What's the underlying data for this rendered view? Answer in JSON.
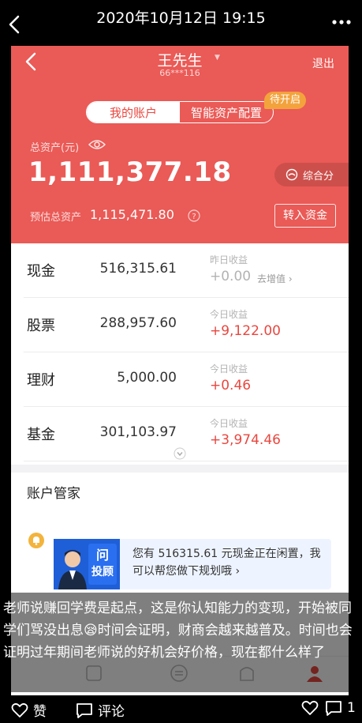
{
  "post": {
    "timestamp": "2020年10月12日 19:15",
    "caption": "老师说赚回学费是起点，这是你认知能力的变现，开始被同学们骂没出息😪时间会证明，财商会越来越普及。时间也会证明过年期间老师说的好机会好价格，现在都什么样了"
  },
  "app": {
    "user_name": "王先生",
    "user_dropdown": "▼",
    "user_id": "66***116",
    "logout": "退出",
    "tabs": [
      {
        "label": "我的账户",
        "active": true
      },
      {
        "label": "智能资产配置",
        "active": false
      }
    ],
    "tab_badge": "待开启",
    "total_assets_label": "总资产(元)",
    "total_assets_value": "1,111,377.18",
    "score_label": "综合分",
    "estimated_label": "预估总资产",
    "estimated_value": "1,115,471.80",
    "transfer_button": "转入资金",
    "assets": [
      {
        "name": "现金",
        "amount": "516,315.61",
        "earn_label": "昨日收益",
        "earn": "+0.00",
        "trend": "zero",
        "link": "去增值 ›"
      },
      {
        "name": "股票",
        "amount": "288,957.60",
        "earn_label": "今日收益",
        "earn": "+9,122.00",
        "trend": "positive",
        "link": ""
      },
      {
        "name": "理财",
        "amount": "5,000.00",
        "earn_label": "今日收益",
        "earn": "+0.46",
        "trend": "positive",
        "link": ""
      },
      {
        "name": "基金",
        "amount": "301,103.97",
        "earn_label": "今日收益",
        "earn": "+3,974.46",
        "trend": "positive",
        "link": ""
      }
    ],
    "manager_title": "账户管家",
    "advisor_badge_line1": "问",
    "advisor_badge_line2": "投顾",
    "advisor_message": "您有 516315.61 元现金正在闲置，我可以帮您做下规划哦 ›",
    "colors": {
      "header": "#ea5a56",
      "profit": "#e9473f",
      "badge": "#f3a33c"
    }
  },
  "actions": {
    "like_label": "赞",
    "comment_label": "评论",
    "comment_count": "1"
  },
  "icons": {
    "back": "chevron-left-icon",
    "more": "more-dots-icon",
    "eye": "eye-icon",
    "like": "heart-icon",
    "comment": "comment-icon"
  }
}
